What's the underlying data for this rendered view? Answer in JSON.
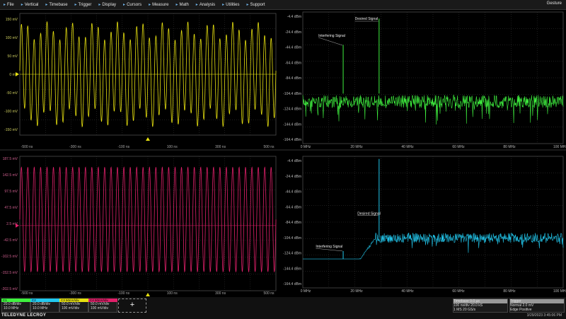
{
  "menu": {
    "items": [
      {
        "label": "File",
        "icon": "file-icon"
      },
      {
        "label": "Vertical",
        "icon": "vertical-icon"
      },
      {
        "label": "Timebase",
        "icon": "timebase-icon"
      },
      {
        "label": "Trigger",
        "icon": "trigger-icon"
      },
      {
        "label": "Display",
        "icon": "display-icon"
      },
      {
        "label": "Cursors",
        "icon": "cursors-icon"
      },
      {
        "label": "Measure",
        "icon": "measure-icon"
      },
      {
        "label": "Math",
        "icon": "math-icon"
      },
      {
        "label": "Analysis",
        "icon": "analysis-icon"
      },
      {
        "label": "Utilities",
        "icon": "utilities-icon"
      },
      {
        "label": "Support",
        "icon": "support-icon"
      }
    ],
    "gesture": "Gesture"
  },
  "colors": {
    "ch1": "#e6e010",
    "spec1": "#3ff03f",
    "ch2": "#e0206a",
    "spec2": "#22c8ee",
    "grid": "#3b3b3b",
    "center": "#6a6a6a"
  },
  "plots": {
    "time_top": {
      "ylabels": [
        "150 mV",
        "100 mV",
        "50 mV",
        "0 mV",
        "-50 mV",
        "-100 mV",
        "-150 mV"
      ],
      "xlabels": [
        "-500 ns",
        "-300 ns",
        "-100 ns",
        "100 ns",
        "300 ns",
        "500 ns"
      ]
    },
    "time_bottom": {
      "ylabels": [
        "187.5 mV",
        "142.5 mV",
        "97.5 mV",
        "47.5 mV",
        "2.5 mV",
        "-42.5 mV",
        "-102.5 mV",
        "-152.5 mV",
        "-202.5 mV"
      ],
      "xlabels": [
        "-500 ns",
        "-300 ns",
        "-100 ns",
        "100 ns",
        "300 ns",
        "500 ns"
      ]
    },
    "spec_top": {
      "ylabels": [
        "-4.4 dBm",
        "-24.4 dBm",
        "-44.4 dBm",
        "-64.4 dBm",
        "-84.4 dBm",
        "-104.4 dBm",
        "-124.4 dBm",
        "-144.4 dBm",
        "-164.4 dBm"
      ],
      "xlabels": [
        "0 MHz",
        "20 MHz",
        "40 MHz",
        "60 MHz",
        "80 MHz",
        "100 MHz"
      ],
      "annotations": {
        "desired": "Desired Signal",
        "interfering": "Interfering Signal"
      }
    },
    "spec_bottom": {
      "ylabels": [
        "-4.4 dBm",
        "-24.4 dBm",
        "-44.4 dBm",
        "-64.4 dBm",
        "-84.4 dBm",
        "-104.4 dBm",
        "-124.4 dBm",
        "-144.4 dBm",
        "-164.4 dBm"
      ],
      "xlabels": [
        "0 MHz",
        "20 MHz",
        "40 MHz",
        "60 MHz",
        "80 MHz",
        "100 MHz"
      ],
      "annotations": {
        "desired": "Desired Signal",
        "interfering": "Interfering Signal"
      }
    }
  },
  "channels": [
    {
      "hdr": "C1",
      "l1": "20.0 dB/div",
      "l2": "10.0 MHz"
    },
    {
      "hdr": "C2",
      "l1": "20.0 dB/div",
      "l2": "10.0 MHz"
    },
    {
      "hdr": "C3  50mV/div",
      "l1": "50.0 mV/div",
      "l2": "100 mV/div"
    },
    {
      "hdr": "C4  50mV/div",
      "l1": "50.0 mV/div",
      "l2": "100 mV/div"
    }
  ],
  "add_label": "+",
  "timebase": {
    "hdr": "Timebase  0.0 µs",
    "l1": "100 ns/div  20.0 kS",
    "l2": "1 MS  20 GS/s",
    "trig_hdr": "Trigger",
    "t1": "Normal  2.0 mV",
    "t2": "Edge  Positive"
  },
  "footer": {
    "brand": "TELEDYNE LECROY",
    "timestamp": "3/29/2023 3:45:06 PM"
  }
}
